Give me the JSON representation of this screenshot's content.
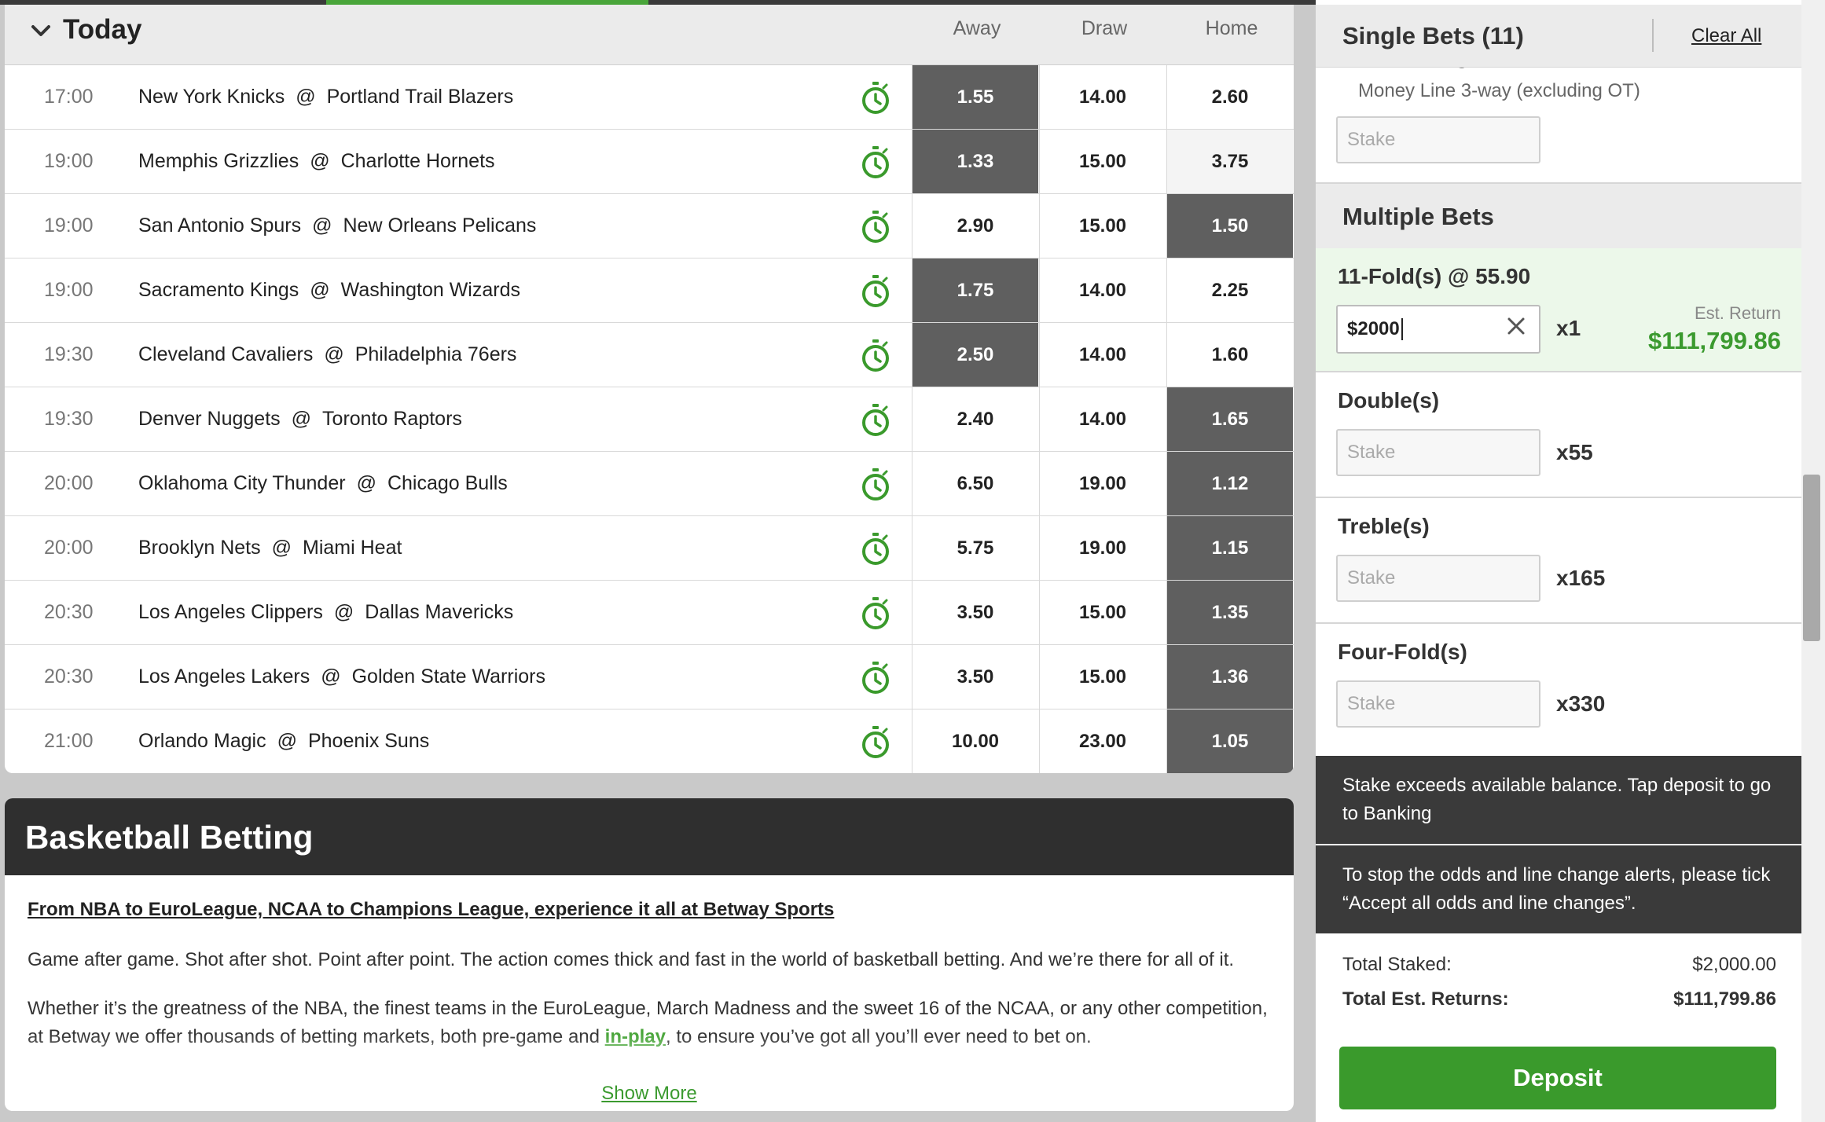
{
  "events": {
    "section_title": "Today",
    "columns": [
      "Away",
      "Draw",
      "Home"
    ],
    "rows": [
      {
        "time": "17:00",
        "away_team": "New York Knicks",
        "home_team": "Portland Trail Blazers",
        "away": "1.55",
        "draw": "14.00",
        "home": "2.60",
        "selected": "away"
      },
      {
        "time": "19:00",
        "away_team": "Memphis Grizzlies",
        "home_team": "Charlotte Hornets",
        "away": "1.33",
        "draw": "15.00",
        "home": "3.75",
        "selected": "away"
      },
      {
        "time": "19:00",
        "away_team": "San Antonio Spurs",
        "home_team": "New Orleans Pelicans",
        "away": "2.90",
        "draw": "15.00",
        "home": "1.50",
        "selected": "home"
      },
      {
        "time": "19:00",
        "away_team": "Sacramento Kings",
        "home_team": "Washington Wizards",
        "away": "1.75",
        "draw": "14.00",
        "home": "2.25",
        "selected": "away"
      },
      {
        "time": "19:30",
        "away_team": "Cleveland Cavaliers",
        "home_team": "Philadelphia 76ers",
        "away": "2.50",
        "draw": "14.00",
        "home": "1.60",
        "selected": "away"
      },
      {
        "time": "19:30",
        "away_team": "Denver Nuggets",
        "home_team": "Toronto Raptors",
        "away": "2.40",
        "draw": "14.00",
        "home": "1.65",
        "selected": "home"
      },
      {
        "time": "20:00",
        "away_team": "Oklahoma City Thunder",
        "home_team": "Chicago Bulls",
        "away": "6.50",
        "draw": "19.00",
        "home": "1.12",
        "selected": "home"
      },
      {
        "time": "20:00",
        "away_team": "Brooklyn Nets",
        "home_team": "Miami Heat",
        "away": "5.75",
        "draw": "19.00",
        "home": "1.15",
        "selected": "home"
      },
      {
        "time": "20:30",
        "away_team": "Los Angeles Clippers",
        "home_team": "Dallas Mavericks",
        "away": "3.50",
        "draw": "15.00",
        "home": "1.35",
        "selected": "home"
      },
      {
        "time": "20:30",
        "away_team": "Los Angeles Lakers",
        "home_team": "Golden State Warriors",
        "away": "3.50",
        "draw": "15.00",
        "home": "1.36",
        "selected": "home"
      },
      {
        "time": "21:00",
        "away_team": "Orlando Magic",
        "home_team": "Phoenix Suns",
        "away": "10.00",
        "draw": "23.00",
        "home": "1.05",
        "selected": "home"
      }
    ],
    "at_symbol": "@"
  },
  "info": {
    "heading": "Basketball Betting",
    "subheading": "From NBA to EuroLeague, NCAA to Champions League, experience it all at Betway Sports",
    "para1": "Game after game. Shot after shot. Point after point. The action comes thick and fast in the world of basketball betting. And we’re there for all of it.",
    "para2_line1": "Whether it’s the greatness of the NBA, the finest teams in the EuroLeague, March Madness and the sweet 16 of the NCAA, or any other competition,",
    "para2_line2_before": "at Betway we offer thousands of betting markets, both pre-game and ",
    "para2_link": "in-play",
    "para2_line2_after": ", to ensure you’ve got all you’ll ever need to bet on.",
    "show_more": "Show More"
  },
  "slip": {
    "title": "Single Bets (11)",
    "clear_all": "Clear All",
    "single_cut_text": "Orlando Magic @ Phoenix Suns,",
    "single_market": "Money Line 3-way (excluding OT)",
    "stake_placeholder": "Stake",
    "multiple_title": "Multiple Bets",
    "fold": {
      "label": "11-Fold(s) @ 55.90",
      "stake": "$2000",
      "multiplier": "x1",
      "est_label": "Est. Return",
      "est_value": "$111,799.86"
    },
    "doubles": {
      "label": "Double(s)",
      "multiplier": "x55"
    },
    "trebles": {
      "label": "Treble(s)",
      "multiplier": "x165"
    },
    "fourfolds": {
      "label": "Four-Fold(s)",
      "multiplier": "x330"
    },
    "alert_balance": "Stake exceeds available balance. Tap deposit to go to Banking",
    "alert_odds": "To stop the odds and line change alerts, please tick “Accept all odds and line changes”.",
    "total_staked_label": "Total Staked:",
    "total_staked_value": "$2,000.00",
    "total_returns_label": "Total Est. Returns:",
    "total_returns_value": "$111,799.86",
    "deposit_label": "Deposit"
  },
  "colors": {
    "accent_green": "#49a53a",
    "selected_odd": "#5f5f5f",
    "dark_panel": "#2f2f2f"
  }
}
